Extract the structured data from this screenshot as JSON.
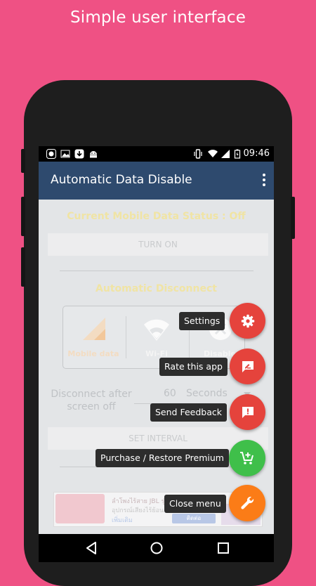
{
  "promo": {
    "headline": "Simple user interface"
  },
  "status_bar": {
    "time": "09:46"
  },
  "app_bar": {
    "title": "Automatic Data Disable"
  },
  "main": {
    "mobile_data_status": "Current Mobile Data Status : Off",
    "turn_on_label": "TURN ON",
    "auto_disconnect_title": "Automatic Disconnect",
    "options": [
      {
        "label": "Mobile data",
        "icon": "signal-icon"
      },
      {
        "label": "Wi-Fi",
        "icon": "wifi-icon"
      },
      {
        "label": "Disable",
        "icon": "close-icon"
      }
    ],
    "disconnect_after_label": "Disconnect after screen off",
    "interval_value": "60",
    "interval_unit": "Seconds",
    "set_interval_label": "SET INTERVAL"
  },
  "ad": {
    "line1": "ลำโพงไร้สาย JBL รุ่น CH",
    "line2": "อุปกรณ์เสียงไร้ย้อนรับ",
    "line3": "เพิ่มเติม",
    "button": "ติดต่อ"
  },
  "fab_menu": [
    {
      "label": "Settings",
      "icon": "gear-icon",
      "color": "#e5433c"
    },
    {
      "label": "Rate this app",
      "icon": "rate-review-icon",
      "color": "#e5433c"
    },
    {
      "label": "Send Feedback",
      "icon": "feedback-icon",
      "color": "#e5433c"
    },
    {
      "label": "Purchase / Restore Premium",
      "icon": "add-cart-icon",
      "color": "#3fbf4a"
    },
    {
      "label": "Close menu",
      "icon": "wrench-icon",
      "color": "#fb7c17"
    }
  ],
  "colors": {
    "background": "#ef5184",
    "app_bar": "#2e4a6e",
    "fab_red": "#e5433c",
    "fab_green": "#3fbf4a",
    "fab_orange": "#fb7c17"
  }
}
